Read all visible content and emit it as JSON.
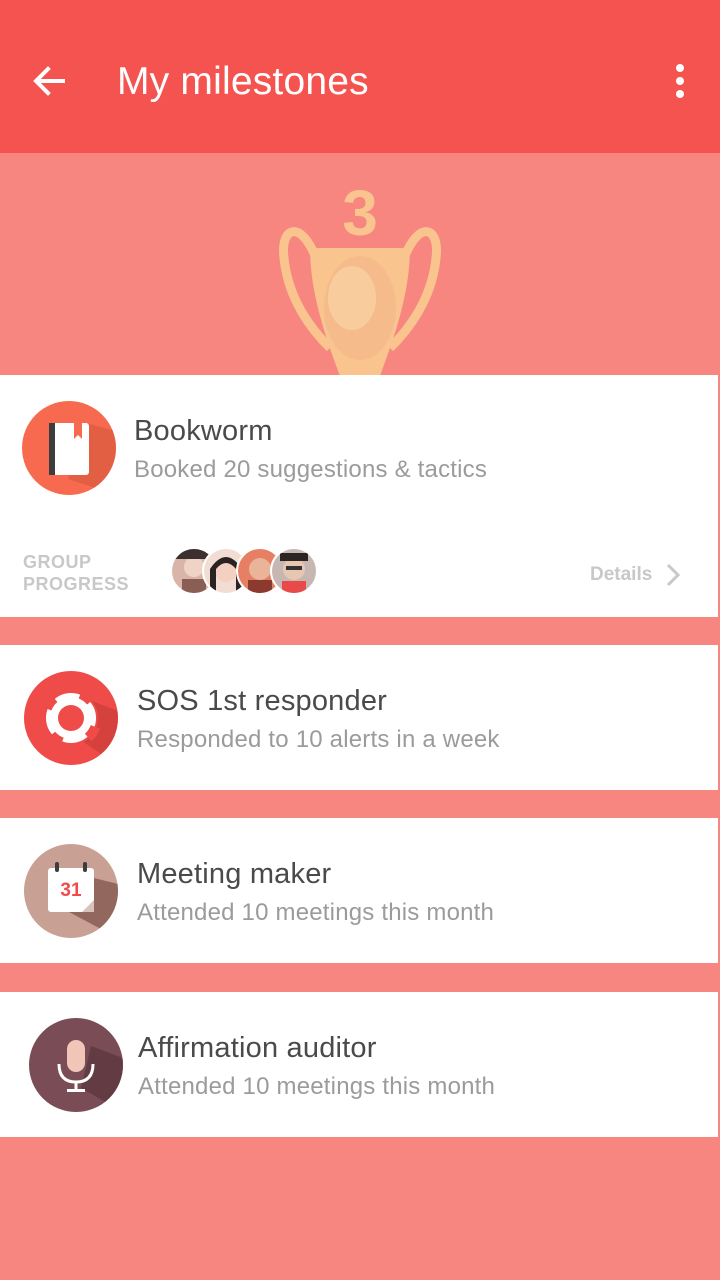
{
  "header": {
    "title": "My milestones",
    "back_icon": "arrow-back-icon",
    "menu_icon": "more-vert-icon"
  },
  "trophy": {
    "count": "3",
    "icon": "trophy-icon"
  },
  "milestones": [
    {
      "title": "Bookworm",
      "subtitle": "Booked 20 suggestions & tactics",
      "icon": "book-icon",
      "badge_color": "#f76a4f",
      "group_progress_label": "GROUP\nPROGRESS",
      "details_label": "Details"
    },
    {
      "title": "SOS 1st responder",
      "subtitle": "Responded to 10 alerts in a week",
      "icon": "lifebuoy-icon",
      "badge_color": "#ef4b48"
    },
    {
      "title": "Meeting maker",
      "subtitle": "Attended 10 meetings this month",
      "icon": "calendar-icon",
      "calendar_day": "31",
      "badge_color": "#c9a094"
    },
    {
      "title": "Affirmation auditor",
      "subtitle": "Attended 10 meetings this month",
      "icon": "microphone-icon",
      "badge_color": "#7a4c56"
    }
  ],
  "colors": {
    "app_bar": "#f4534f",
    "background": "#f78680",
    "trophy": "#f9c48e"
  }
}
